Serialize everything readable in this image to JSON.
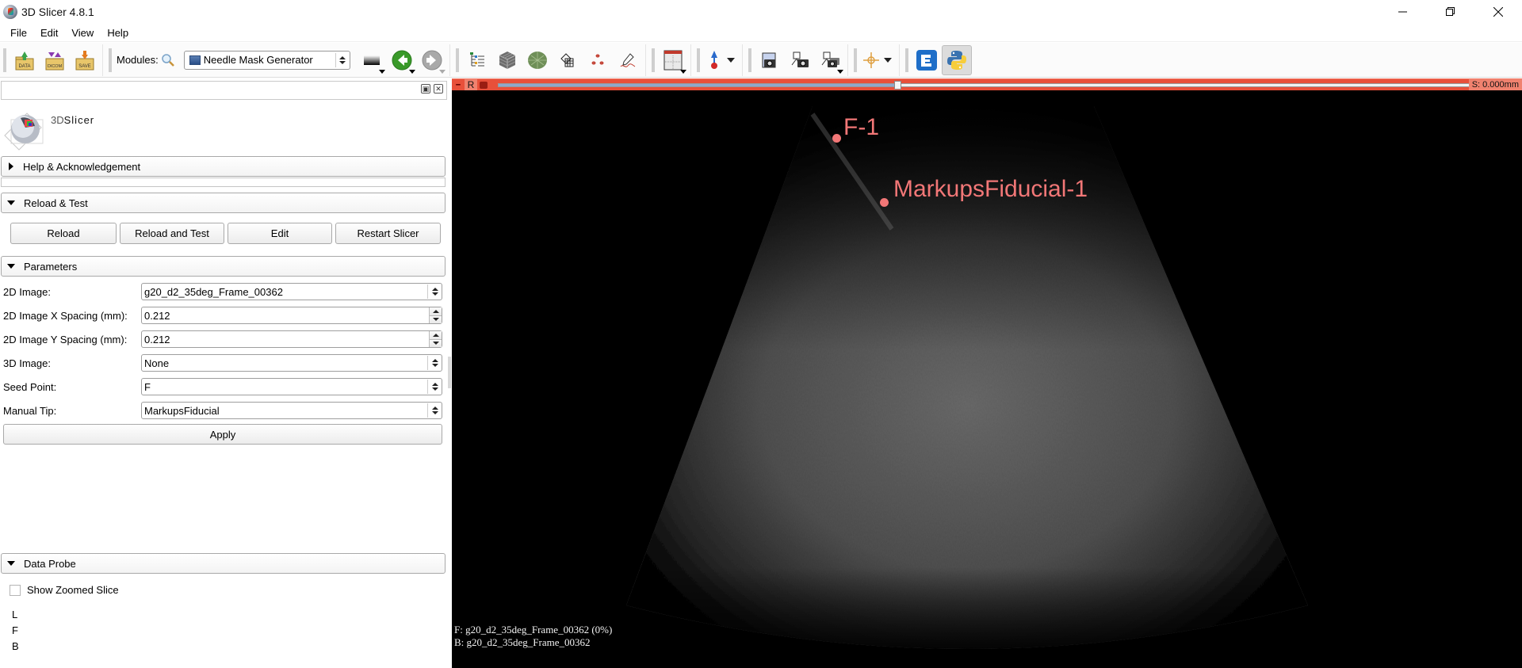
{
  "window": {
    "title": "3D Slicer 4.8.1",
    "controls": [
      "minimize",
      "restore",
      "close"
    ]
  },
  "menubar": {
    "items": [
      "File",
      "Edit",
      "View",
      "Help"
    ]
  },
  "toolbar": {
    "data_label": "DATA",
    "dicom_label": "DICOM",
    "save_label": "SAVE",
    "modules_label": "Modules:",
    "module_selected": "Needle Mask Generator",
    "icons": [
      "search-icon",
      "layout-grayscale-icon",
      "back-icon",
      "forward-icon",
      "data-tree-icon",
      "volumes-icon",
      "models-icon",
      "transforms-icon",
      "markups-icon",
      "editor-icon",
      "layout-icon",
      "mouse-mode-icon",
      "screenshot-icon",
      "scene-view-icon",
      "scene-views-icon",
      "crosshair-icon",
      "extension-manager-icon",
      "python-icon"
    ]
  },
  "left_panel": {
    "logo_text_prefix": "3D",
    "logo_text_main": "Slicer",
    "sections": {
      "help": "Help & Acknowledgement",
      "reload": "Reload & Test",
      "parameters": "Parameters",
      "data_probe": "Data Probe"
    },
    "reload_buttons": [
      "Reload",
      "Reload and Test",
      "Edit",
      "Restart Slicer"
    ],
    "parameters": [
      {
        "label": "2D Image:",
        "value": "g20_d2_35deg_Frame_00362",
        "type": "combo"
      },
      {
        "label": "2D Image X Spacing (mm):",
        "value": "0.212",
        "type": "spin"
      },
      {
        "label": "2D Image Y Spacing (mm):",
        "value": "0.212",
        "type": "spin"
      },
      {
        "label": "3D Image:",
        "value": "None",
        "type": "combo"
      },
      {
        "label": "Seed Point:",
        "value": "F",
        "type": "combo"
      },
      {
        "label": "Manual Tip:",
        "value": "MarkupsFiducial",
        "type": "combo"
      }
    ],
    "apply_label": "Apply",
    "show_zoomed_slice_label": "Show Zoomed Slice",
    "show_zoomed_slice_checked": false,
    "probe_lines": [
      "L",
      "F",
      "B"
    ]
  },
  "slice_view": {
    "orientation_label": "R",
    "color": "#e8503a",
    "slider_fraction": 0.41,
    "offset_text": "S: 0.000mm",
    "fiducials": [
      {
        "label": "F-1",
        "color": "#f27777"
      },
      {
        "label": "MarkupsFiducial-1",
        "color": "#f27777"
      }
    ],
    "foreground_text": "F: g20_d2_35deg_Frame_00362 (0%)",
    "background_text": "B: g20_d2_35deg_Frame_00362"
  }
}
